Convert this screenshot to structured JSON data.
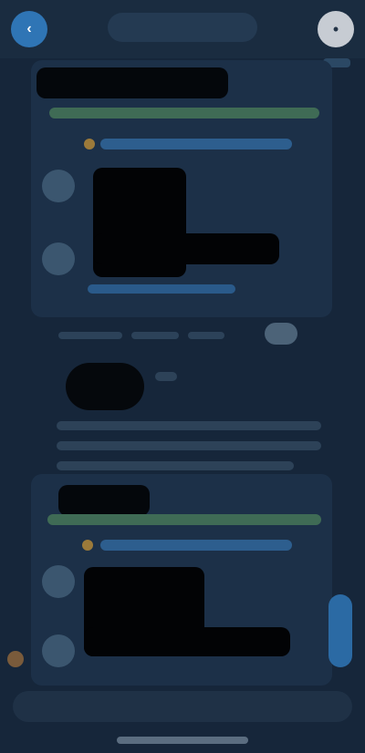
{
  "topbar": {
    "title": "",
    "left_button": "",
    "right_button": ""
  },
  "panel1": {
    "heading": ""
  },
  "panel2": {
    "heading": ""
  },
  "input": {
    "placeholder": ""
  },
  "colors": {
    "background": "#16263a",
    "accent_blue": "#2f75b5",
    "green": "#3f6b55",
    "orange": "#9c7a3a"
  },
  "icons": {
    "left": "blue-avatar-icon",
    "right": "gray-avatar-icon"
  }
}
